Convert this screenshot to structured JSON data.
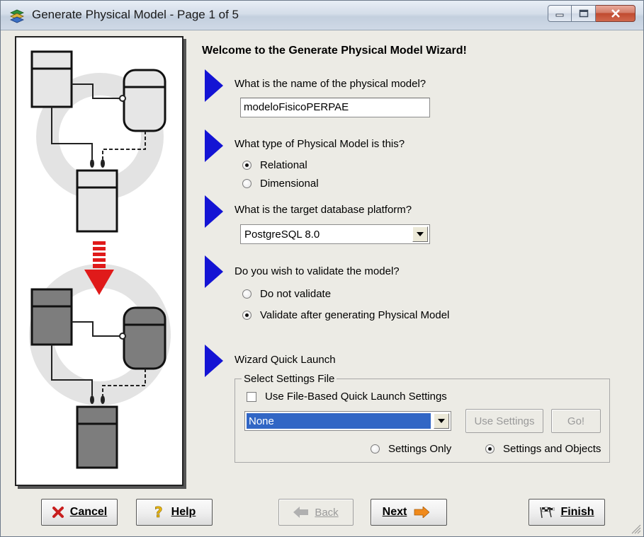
{
  "window": {
    "title": "Generate Physical Model - Page 1 of 5",
    "controls": {
      "minimize": "minimize",
      "maximize": "maximize",
      "close": "close"
    }
  },
  "wizard": {
    "heading": "Welcome to the Generate Physical Model Wizard!",
    "q_name": "What is the name of the physical model?",
    "model_name": "modeloFisicoPERPAE",
    "q_type": "What type of Physical Model is this?",
    "type_options": [
      {
        "label": "Relational",
        "selected": true
      },
      {
        "label": "Dimensional",
        "selected": false
      }
    ],
    "q_platform": "What is the target database platform?",
    "platform_value": "PostgreSQL 8.0",
    "q_validate": "Do you wish to validate the model?",
    "validate_options": [
      {
        "label": "Do not validate",
        "selected": false
      },
      {
        "label": "Validate after generating Physical Model",
        "selected": true
      }
    ],
    "quick_launch_label": "Wizard Quick Launch",
    "settings_group_label": "Select Settings File",
    "use_file_settings_label": "Use File-Based Quick Launch Settings",
    "use_file_settings_checked": false,
    "settings_file_value": "None",
    "use_settings_button": "Use Settings",
    "go_button": "Go!",
    "scope_options": [
      {
        "label": "Settings Only",
        "selected": false
      },
      {
        "label": "Settings and Objects",
        "selected": true
      }
    ]
  },
  "footer": {
    "cancel": "Cancel",
    "help": "Help",
    "back": "Back",
    "next": "Next",
    "finish": "Finish"
  },
  "icons": {
    "title": "stack-layers-icon",
    "step_marker": "blue-triangle-icon",
    "cancel": "red-x-icon",
    "help": "question-mark-icon",
    "back": "left-arrow-icon",
    "next": "right-arrow-icon",
    "finish": "checkered-flag-icon"
  },
  "colors": {
    "step_marker": "#1414d4",
    "selection": "#3166c5",
    "cancel_icon": "#c81e1e",
    "next_arrow": "#f08a1c",
    "conversion_arrow": "#e01a1a"
  }
}
